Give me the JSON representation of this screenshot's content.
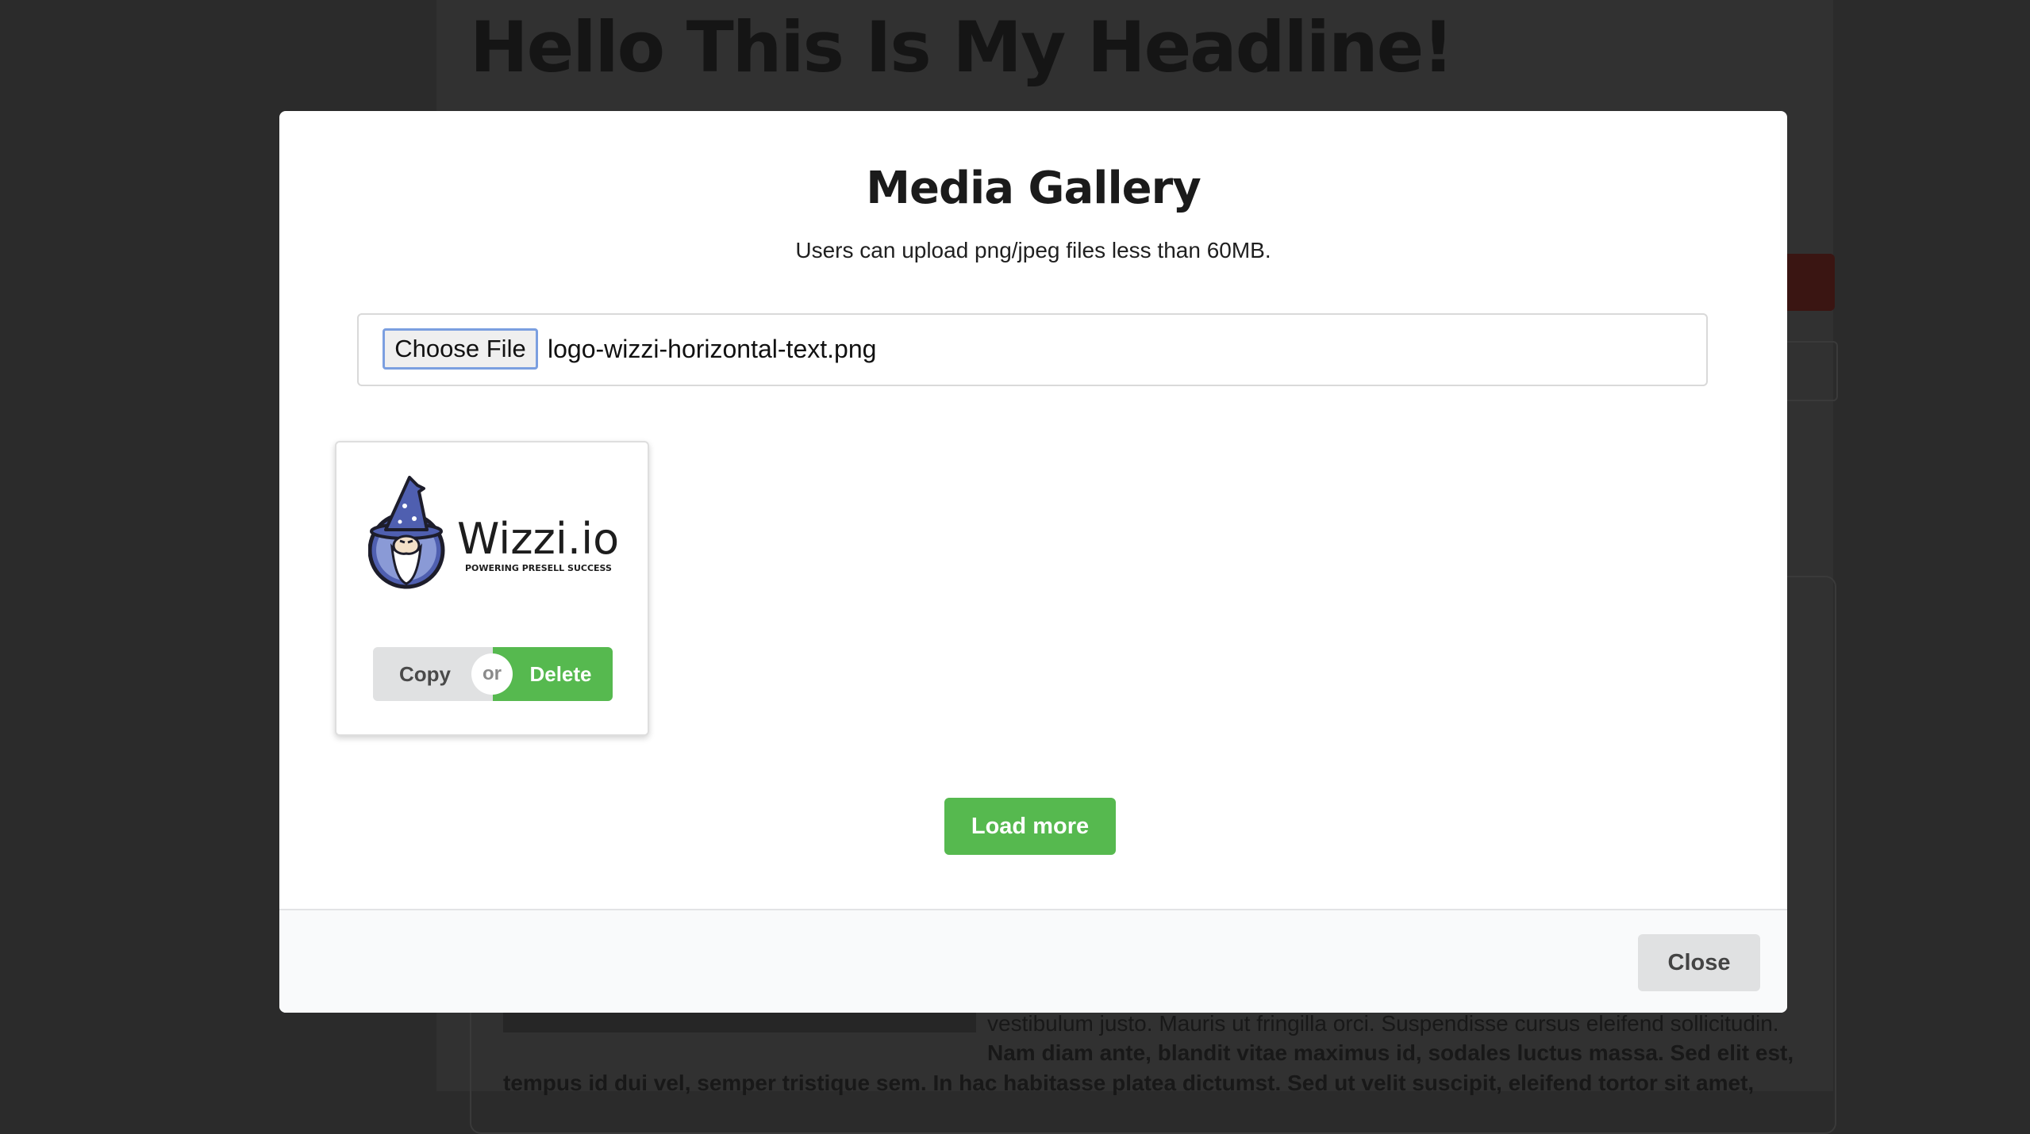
{
  "background": {
    "headline": "Hello This Is My Headline!",
    "text_line_1": "vestibulum justo.  Mauris ut fringilla orci. Suspendisse cursus eleifend sollicitudin.",
    "text_line_2": "Nam diam ante, blandit vitae maximus id, sodales luctus massa. Sed elit est,",
    "text_line_3": "tempus id dui vel, semper tristique sem. In hac habitasse platea dictumst. Sed ut velit suscipit, eleifend tortor sit amet,"
  },
  "modal": {
    "title": "Media Gallery",
    "subtitle": "Users can upload png/jpeg files less than 60MB.",
    "file_input": {
      "button_label": "Choose File",
      "file_name": "logo-wizzi-horizontal-text.png"
    },
    "gallery": [
      {
        "logo_text": "Wizzi.io",
        "logo_tagline": "POWERING PRESELL SUCCESS",
        "copy_label": "Copy",
        "or_label": "or",
        "delete_label": "Delete"
      }
    ],
    "load_more_label": "Load more",
    "close_label": "Close"
  },
  "colors": {
    "primary_green": "#56b94f",
    "secondary_grey": "#e0e1e2",
    "overlay": "#2b2b2b",
    "wizard_blue": "#4f5fb0"
  }
}
